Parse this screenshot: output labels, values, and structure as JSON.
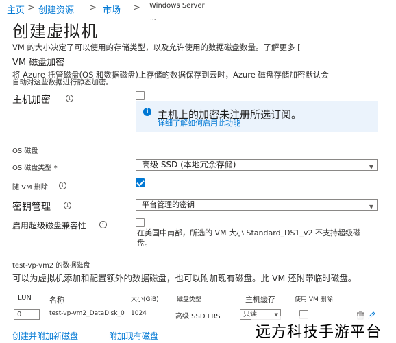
{
  "breadcrumb": {
    "items": [
      "主页",
      "创建资源",
      "市场"
    ],
    "separator": ">",
    "sub_label": "Windows Server",
    "dots": "..."
  },
  "page_title": "创建虚拟机",
  "intro": {
    "line1": "VM 的大小决定了可以使用的存储类型，以及允许使用的数据磁盘数量。了解更多 ["
  },
  "vm_disk_encryption": {
    "section_title": "VM 磁盘加密",
    "line1": "将 Azure 托管磁盘(OS 和数据磁盘)上存储的数据保存到云时，Azure 磁盘存储加密默认会",
    "line2": "自动对这些数据进行静态加密。",
    "host_encryption_label": "主机加密",
    "host_encryption_checked": false,
    "info_box": {
      "message": "主机上的加密未注册所选订阅。",
      "link": "详细了解如何启用此功能"
    }
  },
  "os_disk": {
    "section_title": "OS 磁盘",
    "type_label": "OS 磁盘类型 *",
    "type_value": "高级 SSD (本地冗余存储)",
    "delete_with_vm_label": "随 VM 删除",
    "delete_with_vm_checked": true,
    "key_management_label": "密钥管理",
    "key_management_value": "平台管理的密钥",
    "ultra_compat_label": "启用超级磁盘兼容性",
    "ultra_compat_checked": false,
    "ultra_compat_note": "在美国中南部，所选的 VM 大小 Standard_DS1_v2 不支持超级磁盘。"
  },
  "data_disks": {
    "section_title": "test-vp-vm2 的数据磁盘",
    "description": "可以为虚拟机添加和配置额外的数据磁盘，也可以附加现有磁盘。此 VM 还附带临时磁盘。",
    "columns": [
      "LUN",
      "名称",
      "大小(GiB)",
      "磁盘类型",
      "主机缓存",
      "使用 VM 删除"
    ],
    "rows": [
      {
        "lun": "0",
        "name": "test-vp-vm2_DataDisk_0",
        "size": "1024",
        "type": "高级 SSD LRS",
        "cache": "只读",
        "delete_with_vm": false
      }
    ],
    "create_attach_label": "创建并附加新磁盘",
    "attach_existing_label": "附加现有磁盘"
  },
  "watermark": "远方科技手游平台",
  "colors": {
    "link": "#0078d4",
    "info_bg": "#ebf3fc",
    "checkbox_checked": "#0078d4"
  }
}
